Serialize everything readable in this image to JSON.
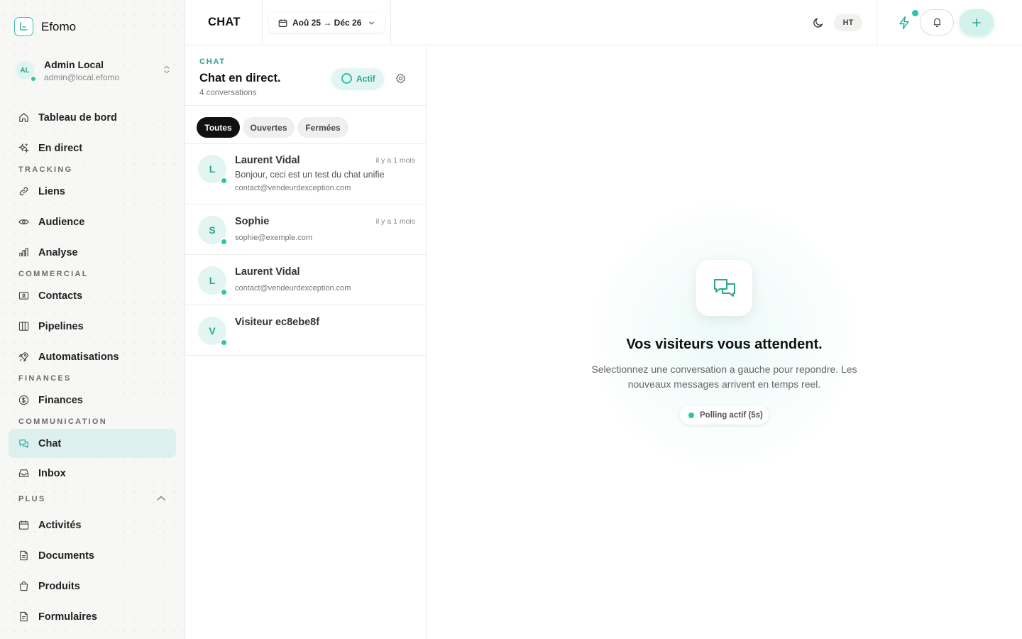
{
  "brand": {
    "name": "Efomo"
  },
  "user": {
    "initials": "AL",
    "name": "Admin Local",
    "email": "admin@local.efomo"
  },
  "nav": {
    "dashboard": "Tableau de bord",
    "live": "En direct",
    "section_tracking": "TRACKING",
    "links": "Liens",
    "audience": "Audience",
    "analyse": "Analyse",
    "section_commercial": "COMMERCIAL",
    "contacts": "Contacts",
    "pipelines": "Pipelines",
    "automations": "Automatisations",
    "section_finances": "FINANCES",
    "finances": "Finances",
    "section_communication": "COMMUNICATION",
    "chat": "Chat",
    "inbox": "Inbox",
    "section_plus": "PLUS",
    "activities": "Activités",
    "documents": "Documents",
    "products": "Produits",
    "forms": "Formulaires"
  },
  "topbar": {
    "title": "CHAT",
    "date_range": "Aoû 25 → Déc 26",
    "currency": "HT"
  },
  "panel": {
    "kicker": "CHAT",
    "title": "Chat en direct.",
    "subtitle": "4 conversations",
    "status": "Actif",
    "filters": [
      "Toutes",
      "Ouvertes",
      "Fermées"
    ],
    "conversations": [
      {
        "initial": "L",
        "name": "Laurent Vidal",
        "time": "il y a 1 mois",
        "message": "Bonjour, ceci est un test du chat unifie",
        "email": "contact@vendeurdexception.com"
      },
      {
        "initial": "S",
        "name": "Sophie",
        "time": "il y a 1 mois",
        "message": "",
        "email": "sophie@exemple.com"
      },
      {
        "initial": "L",
        "name": "Laurent Vidal",
        "time": "",
        "message": "",
        "email": "contact@vendeurdexception.com"
      },
      {
        "initial": "V",
        "name": "Visiteur ec8ebe8f",
        "time": "",
        "message": "",
        "email": ""
      }
    ]
  },
  "empty_state": {
    "title": "Vos visiteurs vous attendent.",
    "text": "Selectionnez une conversation a gauche pour repondre. Les nouveaux messages arrivent en temps reel.",
    "polling": "Polling actif (5s)"
  },
  "colors": {
    "accent": "#2ec4a9",
    "accent_text": "#2aa594",
    "active_bg": "#dcf1ed"
  },
  "icons": {
    "dashboard": "home-icon",
    "live": "sparkles-icon",
    "links": "link-icon",
    "audience": "eye-icon",
    "analyse": "bar-chart-icon",
    "contacts": "contact-card-icon",
    "pipelines": "columns-icon",
    "automations": "rocket-icon",
    "finances": "dollar-icon",
    "chat": "chat-bubbles-icon",
    "inbox": "inbox-icon",
    "activities": "calendar-icon",
    "documents": "document-icon",
    "products": "shopping-bag-icon",
    "forms": "form-icon"
  }
}
